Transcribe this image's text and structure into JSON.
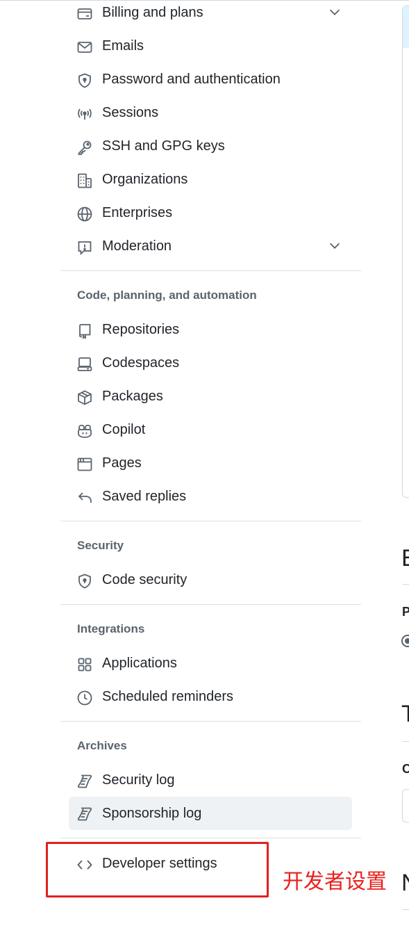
{
  "sidebar": {
    "access_items": [
      {
        "label": "Billing and plans",
        "icon": "credit-card-icon",
        "expandable": true
      },
      {
        "label": "Emails",
        "icon": "mail-icon"
      },
      {
        "label": "Password and authentication",
        "icon": "shield-lock-icon"
      },
      {
        "label": "Sessions",
        "icon": "broadcast-icon"
      },
      {
        "label": "SSH and GPG keys",
        "icon": "key-icon"
      },
      {
        "label": "Organizations",
        "icon": "organization-icon"
      },
      {
        "label": "Enterprises",
        "icon": "globe-icon"
      },
      {
        "label": "Moderation",
        "icon": "report-icon",
        "expandable": true
      }
    ],
    "code_heading": "Code, planning, and automation",
    "code_items": [
      {
        "label": "Repositories",
        "icon": "repo-icon"
      },
      {
        "label": "Codespaces",
        "icon": "codespaces-icon"
      },
      {
        "label": "Packages",
        "icon": "package-icon"
      },
      {
        "label": "Copilot",
        "icon": "copilot-icon"
      },
      {
        "label": "Pages",
        "icon": "browser-icon"
      },
      {
        "label": "Saved replies",
        "icon": "reply-icon"
      }
    ],
    "security_heading": "Security",
    "security_items": [
      {
        "label": "Code security",
        "icon": "shield-lock-icon"
      }
    ],
    "integrations_heading": "Integrations",
    "integrations_items": [
      {
        "label": "Applications",
        "icon": "apps-icon"
      },
      {
        "label": "Scheduled reminders",
        "icon": "clock-icon"
      }
    ],
    "archives_heading": "Archives",
    "archives_items": [
      {
        "label": "Security log",
        "icon": "log-icon"
      },
      {
        "label": "Sponsorship log",
        "icon": "log-icon",
        "active": true
      }
    ],
    "developer_settings": {
      "label": "Developer settings",
      "icon": "code-icon"
    }
  },
  "annotation": {
    "text": "开发者设置",
    "color": "#e8211d"
  },
  "right_pane_fragments": [
    "E",
    "P",
    "T",
    "C",
    "N"
  ],
  "colors": {
    "text": "#1f2328",
    "muted": "#59636e",
    "active_bg": "#eff2f4",
    "divider": "#d8dee4"
  }
}
